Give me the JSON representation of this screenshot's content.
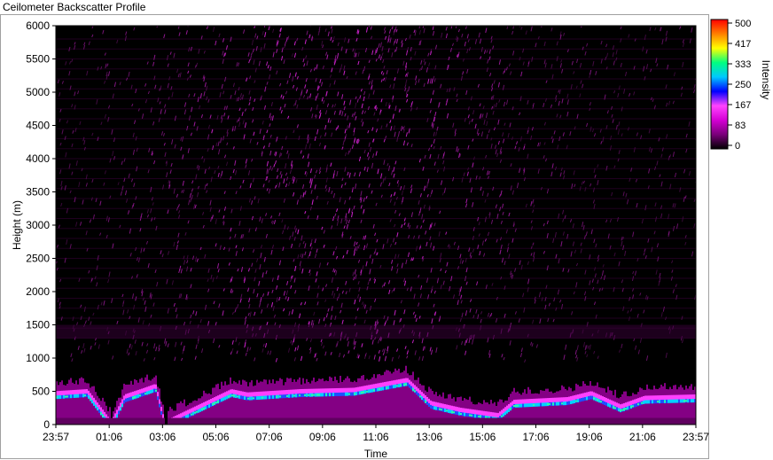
{
  "window": {
    "title": "Ceilometer Backscatter Profile"
  },
  "chart_data": {
    "type": "heatmap",
    "title": "Ceilometer Backscatter Profile",
    "xlabel": "Time",
    "ylabel": "Height (m)",
    "colorbar_label": "Intensity",
    "x_ticks": [
      "23:57",
      "01:06",
      "03:06",
      "05:06",
      "07:06",
      "09:06",
      "11:06",
      "13:06",
      "15:06",
      "17:06",
      "19:06",
      "21:06",
      "23:57"
    ],
    "y_ticks": [
      0,
      500,
      1000,
      1500,
      2000,
      2500,
      3000,
      3500,
      4000,
      4500,
      5000,
      5500,
      6000
    ],
    "ylim": [
      0,
      6000
    ],
    "colorbar_ticks": [
      "500",
      "417",
      "333",
      "250",
      "167",
      "83",
      "0"
    ],
    "colorbar_range": [
      0,
      500
    ],
    "colormap": [
      "#000000",
      "#7a007a",
      "#d400d4",
      "#ff44ff",
      "#0000ff",
      "#00c8ff",
      "#00ff80",
      "#ffff00",
      "#ff8000",
      "#ff0000"
    ],
    "boundary_layer_height_m": [
      {
        "time": "23:57",
        "height": 450
      },
      {
        "time": "01:06",
        "height": 480
      },
      {
        "time": "02:00",
        "height": 0
      },
      {
        "time": "02:30",
        "height": 400
      },
      {
        "time": "03:06",
        "height": 480
      },
      {
        "time": "03:40",
        "height": 560
      },
      {
        "time": "04:00",
        "height": 0
      },
      {
        "time": "06:30",
        "height": 480
      },
      {
        "time": "07:06",
        "height": 430
      },
      {
        "time": "09:06",
        "height": 480
      },
      {
        "time": "11:06",
        "height": 500
      },
      {
        "time": "13:06",
        "height": 650
      },
      {
        "time": "14:00",
        "height": 300
      },
      {
        "time": "15:06",
        "height": 200
      },
      {
        "time": "16:30",
        "height": 120
      },
      {
        "time": "17:06",
        "height": 320
      },
      {
        "time": "19:06",
        "height": 360
      },
      {
        "time": "20:00",
        "height": 450
      },
      {
        "time": "21:06",
        "height": 250
      },
      {
        "time": "22:00",
        "height": 380
      },
      {
        "time": "23:57",
        "height": 400
      }
    ],
    "upper_noise_band_m": [
      1300,
      1500
    ],
    "grid": false
  }
}
